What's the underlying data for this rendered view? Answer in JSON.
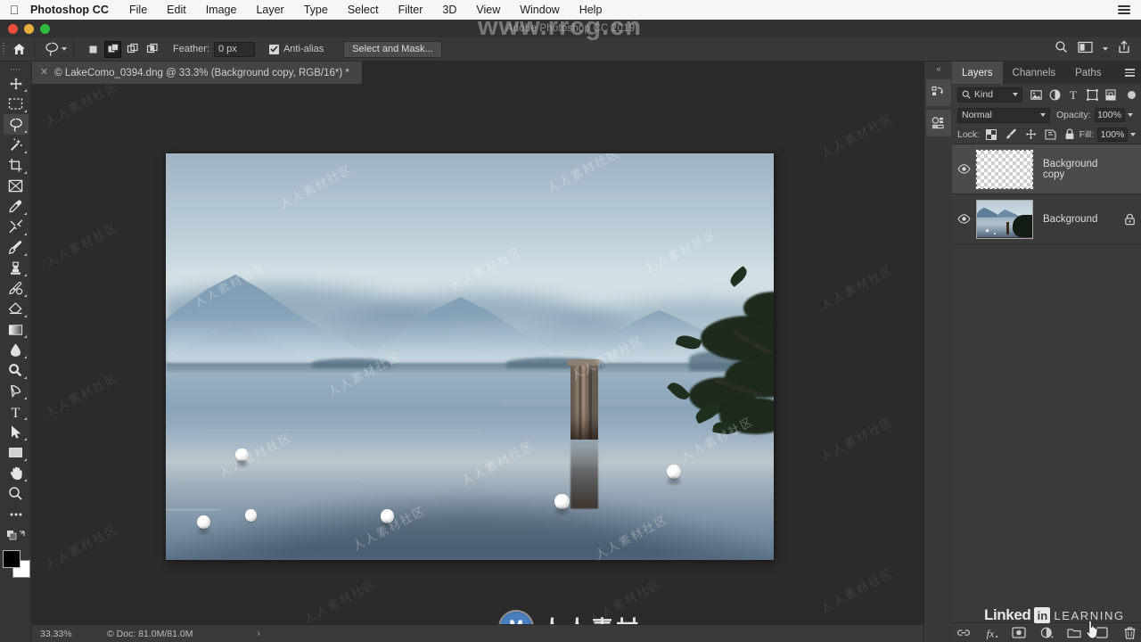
{
  "macbar": {
    "app_name": "Photoshop CC",
    "apple_icon": "apple-logo-icon",
    "menus": [
      "File",
      "Edit",
      "Image",
      "Layer",
      "Type",
      "Select",
      "Filter",
      "3D",
      "View",
      "Window",
      "Help"
    ],
    "right_icon": "menu-list-icon"
  },
  "window": {
    "title": "Adobe Photoshop CC 2019",
    "traffic_lights": [
      "close",
      "minimize",
      "zoom"
    ]
  },
  "watermarks": {
    "title_overlay": "www.rrcg.cn",
    "center_text": "人人素材",
    "center_logo": "M",
    "tile_text": "人人素材社区"
  },
  "options_bar": {
    "home_icon": "home-icon",
    "tool_icon": "lasso-tool-icon",
    "tool_chevron": "chevron-down-icon",
    "selection_modes": [
      {
        "name": "new-selection",
        "active": false
      },
      {
        "name": "add-to-selection",
        "active": true
      },
      {
        "name": "subtract-from-selection",
        "active": false
      },
      {
        "name": "intersect-with-selection",
        "active": false
      }
    ],
    "feather_label": "Feather:",
    "feather_value": "0 px",
    "antialias_label": "Anti-alias",
    "antialias_checked": true,
    "select_and_mask_label": "Select and Mask...",
    "right_icons": [
      "search-icon",
      "workspace-arrange-icon",
      "chevron-down-icon",
      "share-icon"
    ]
  },
  "toolbar": {
    "tools": [
      {
        "name": "move-tool",
        "active": false,
        "has_corner": true
      },
      {
        "name": "rectangular-marquee-tool",
        "active": false,
        "has_corner": true
      },
      {
        "name": "lasso-tool",
        "active": true,
        "has_corner": true
      },
      {
        "name": "quick-selection-tool",
        "active": false,
        "has_corner": true
      },
      {
        "name": "crop-tool",
        "active": false,
        "has_corner": true
      },
      {
        "name": "frame-tool",
        "active": false,
        "has_corner": false
      },
      {
        "name": "eyedropper-tool",
        "active": false,
        "has_corner": true
      },
      {
        "name": "spot-healing-brush-tool",
        "active": false,
        "has_corner": true
      },
      {
        "name": "brush-tool",
        "active": false,
        "has_corner": true
      },
      {
        "name": "clone-stamp-tool",
        "active": false,
        "has_corner": true
      },
      {
        "name": "history-brush-tool",
        "active": false,
        "has_corner": true
      },
      {
        "name": "eraser-tool",
        "active": false,
        "has_corner": true
      },
      {
        "name": "gradient-tool",
        "active": false,
        "has_corner": true
      },
      {
        "name": "blur-tool",
        "active": false,
        "has_corner": true
      },
      {
        "name": "dodge-tool",
        "active": false,
        "has_corner": true
      },
      {
        "name": "pen-tool",
        "active": false,
        "has_corner": true
      },
      {
        "name": "type-tool",
        "active": false,
        "has_corner": true
      },
      {
        "name": "path-selection-tool",
        "active": false,
        "has_corner": true
      },
      {
        "name": "rectangle-tool",
        "active": false,
        "has_corner": true
      },
      {
        "name": "hand-tool",
        "active": false,
        "has_corner": true
      },
      {
        "name": "zoom-tool",
        "active": false,
        "has_corner": false
      },
      {
        "name": "edit-toolbar-more",
        "active": false,
        "has_corner": false
      }
    ],
    "foreground_color": "#000000",
    "background_color": "#ffffff"
  },
  "document": {
    "tab_title": "© LakeComo_0394.dng @ 33.3% (Background copy, RGB/16*) *",
    "close_icon": "close-icon"
  },
  "status_bar": {
    "zoom": "33.33%",
    "doc_info": "© Doc: 81.0M/81.0M",
    "expand_icon": "chevron-right-icon"
  },
  "dock": {
    "collapse_icon": "collapse-panels-icon",
    "buttons": [
      {
        "name": "history-panel-icon"
      },
      {
        "name": "properties-panel-icon"
      }
    ]
  },
  "layers_panel": {
    "tabs": [
      {
        "label": "Layers",
        "active": true
      },
      {
        "label": "Channels",
        "active": false
      },
      {
        "label": "Paths",
        "active": false
      }
    ],
    "menu_icon": "panel-menu-icon",
    "filter": {
      "search_icon": "search-icon",
      "kind_label": "Kind",
      "chevron": "chevron-down-icon",
      "icons": [
        "pixel-layer-filter-icon",
        "adjustment-layer-filter-icon",
        "type-layer-filter-icon",
        "shape-layer-filter-icon",
        "smart-object-filter-icon"
      ],
      "toggle": "filter-toggle-icon"
    },
    "blend_mode": "Normal",
    "opacity_label": "Opacity:",
    "opacity_value": "100%",
    "lock_label": "Lock:",
    "lock_icons": [
      "lock-transparent-pixels-icon",
      "lock-image-pixels-icon",
      "lock-position-icon",
      "lock-artboard-nesting-icon",
      "lock-all-icon"
    ],
    "fill_label": "Fill:",
    "fill_value": "100%",
    "layers": [
      {
        "name": "Background copy",
        "visible": true,
        "selected": true,
        "locked": false,
        "thumbnail": "transparent-checkerboard"
      },
      {
        "name": "Background",
        "visible": true,
        "selected": false,
        "locked": true,
        "thumbnail": "lake-photo"
      }
    ],
    "footer_buttons": [
      "link-layers-icon",
      "add-layer-style-icon",
      "add-layer-mask-icon",
      "new-adjustment-layer-icon",
      "new-group-icon",
      "new-layer-icon",
      "delete-layer-icon"
    ]
  },
  "branding": {
    "linkedin_word": "Linked",
    "in_badge": "in",
    "learning_word": "LEARNING"
  },
  "colors": {
    "panel_bg": "#3a3a3a",
    "options_bar_bg": "#393939",
    "canvas_bg": "#2b2b2b",
    "toolbar_bg": "#353535",
    "selected_layer_bg": "#4b4b4b",
    "text": "#dcdcdc",
    "title_bar": "#323232"
  }
}
